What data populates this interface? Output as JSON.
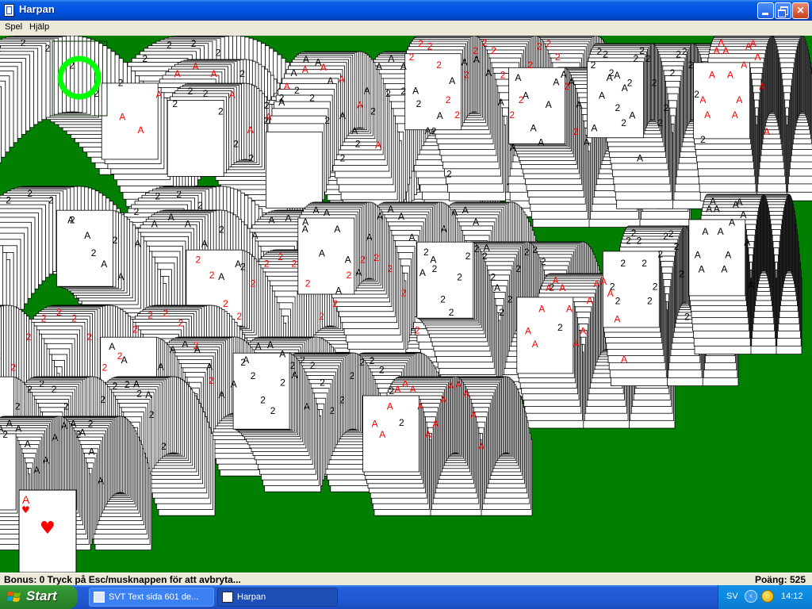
{
  "window": {
    "title": "Harpan",
    "icon": "cards-icon",
    "controls": [
      "minimize-icon",
      "restore-icon",
      "close-icon"
    ]
  },
  "menu": {
    "items": [
      {
        "label": "Spel"
      },
      {
        "label": "Hjälp"
      }
    ]
  },
  "game": {
    "felt_color": "#007f00",
    "stock_marker_color": "#00ff00",
    "card_text": {
      "rank_ace": "A",
      "rank_two": "2"
    },
    "visible_card": {
      "rank": "A",
      "suit": "♥",
      "color": "#ff0000"
    }
  },
  "status": {
    "bonus": "Bonus: 0  Tryck på Esc/musknappen för att avbryta...",
    "score": "Poäng: 525"
  },
  "taskbar": {
    "start_label": "Start",
    "tasks": [
      {
        "label": "SVT Text sida 601 de...",
        "icon": "browser-icon",
        "active": false
      },
      {
        "label": "Harpan",
        "icon": "cards-icon",
        "active": true
      }
    ],
    "tray": {
      "language": "SV",
      "clock": "14:12",
      "icons": [
        "chevron-left-icon",
        "network-globe-icon"
      ]
    }
  }
}
